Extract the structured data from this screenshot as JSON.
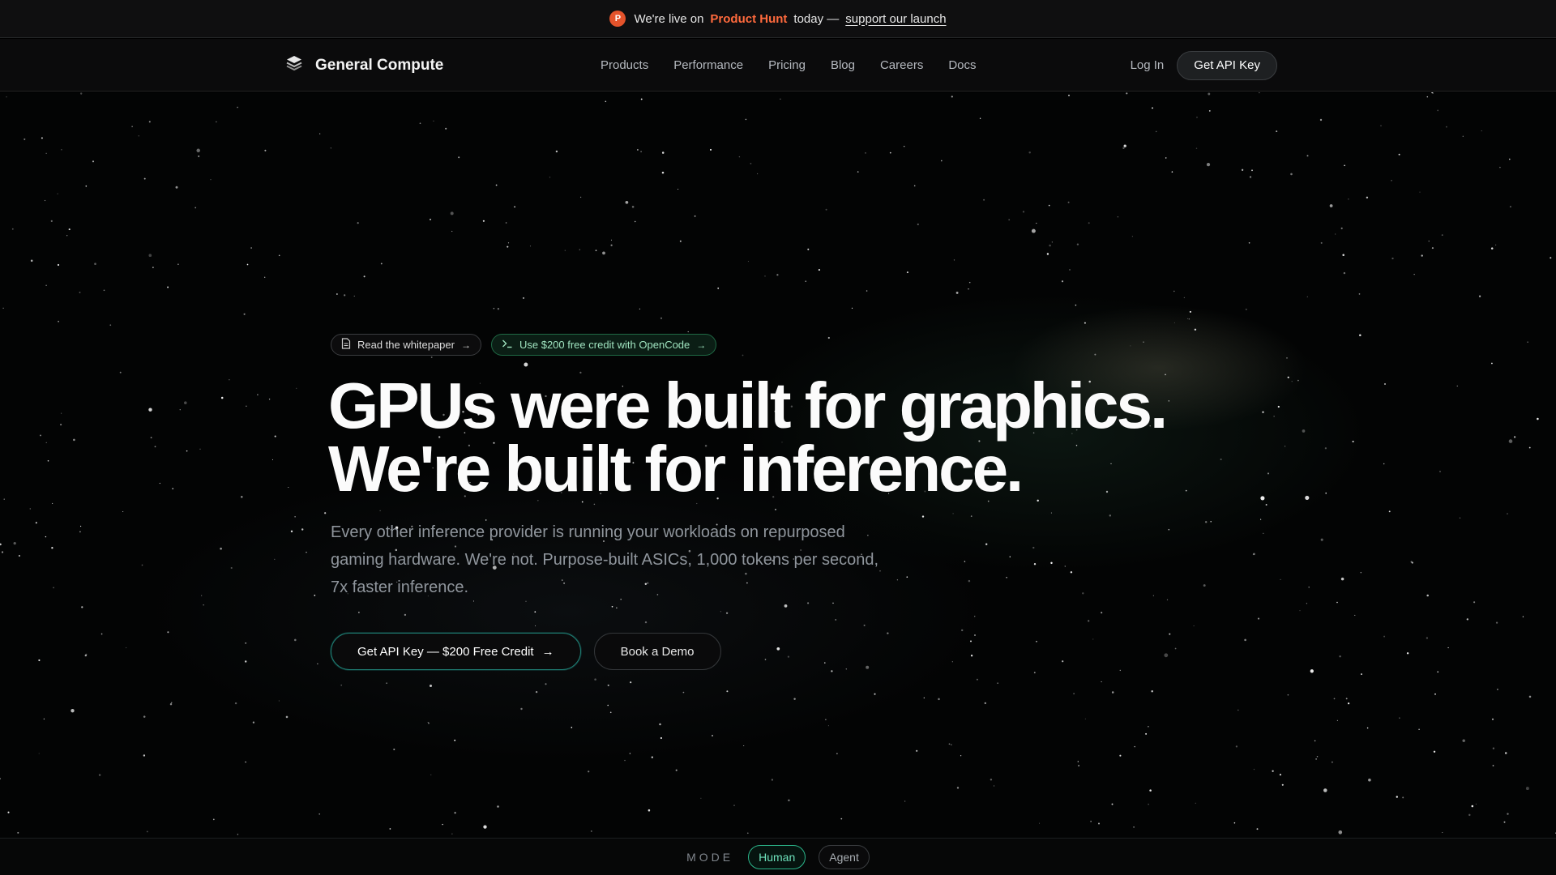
{
  "announcement": {
    "badge_letter": "P",
    "prefix": "We're live on",
    "product_hunt": "Product Hunt",
    "middle": "today —",
    "link": "support our launch"
  },
  "nav": {
    "brand": "General Compute",
    "links": [
      "Products",
      "Performance",
      "Pricing",
      "Blog",
      "Careers",
      "Docs"
    ],
    "login": "Log In",
    "api_key": "Get API Key"
  },
  "hero": {
    "pill_whitepaper": "Read the whitepaper",
    "pill_credit": "Use $200 free credit with OpenCode",
    "headline_line1": "GPUs were built for graphics.",
    "headline_line2": "We're built for inference.",
    "subtext": "Every other inference provider is running your workloads on repurposed gaming hardware. We're not. Purpose-built ASICs, 1,000 tokens per second, 7x faster inference.",
    "cta_primary": "Get API Key — $200 Free Credit",
    "cta_secondary": "Book a Demo"
  },
  "mode": {
    "label": "MODE",
    "human": "Human",
    "agent": "Agent",
    "selected": "Human"
  },
  "colors": {
    "product_hunt": "#ff6a3d",
    "accent_green": "#2bb58a",
    "background": "#000000"
  },
  "icons": {
    "brand": "stacked-layers-icon",
    "whitepaper": "document-icon",
    "terminal": "terminal-prompt-icon",
    "arrow": "arrow-right-icon"
  }
}
